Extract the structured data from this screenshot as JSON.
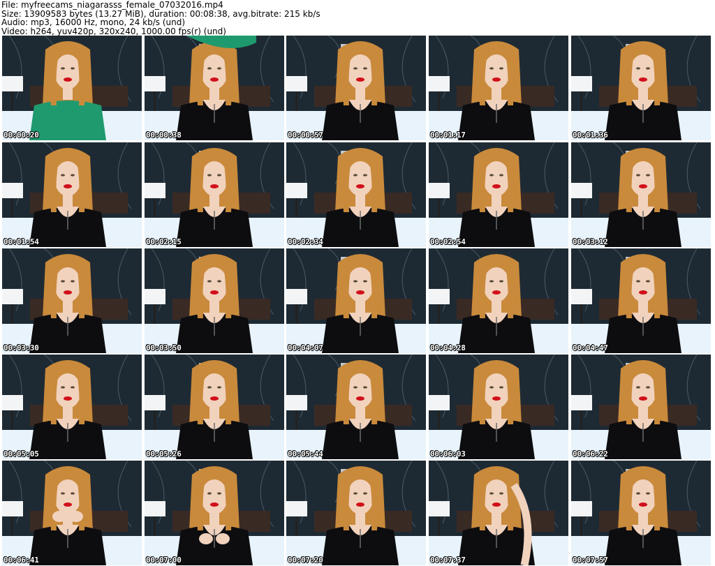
{
  "header": {
    "file_line": "File: myfreecams_niagarasss_female_07032016.mp4",
    "size_line": "Size: 13909583 bytes (13.27 MiB), duration: 00:08:38, avg.bitrate: 215 kb/s",
    "audio_line": "Audio: mp3, 16000 Hz, mono, 24 kb/s (und)",
    "video_line": "Video: h264, yuv420p, 320x240, 1000.00 fps(r) (und)"
  },
  "thumbnails": [
    {
      "timestamp": "00:00:20",
      "top": "green-sweater"
    },
    {
      "timestamp": "00:00:38",
      "top": "black-shirt-removing-sweater"
    },
    {
      "timestamp": "00:00:57",
      "top": "black-shirt"
    },
    {
      "timestamp": "00:01:17",
      "top": "black-shirt"
    },
    {
      "timestamp": "00:01:36",
      "top": "black-shirt"
    },
    {
      "timestamp": "00:01:54",
      "top": "black-shirt"
    },
    {
      "timestamp": "00:02:15",
      "top": "black-shirt"
    },
    {
      "timestamp": "00:02:34",
      "top": "black-shirt"
    },
    {
      "timestamp": "00:02:54",
      "top": "black-shirt"
    },
    {
      "timestamp": "00:03:12",
      "top": "black-shirt"
    },
    {
      "timestamp": "00:03:30",
      "top": "black-shirt"
    },
    {
      "timestamp": "00:03:50",
      "top": "black-shirt"
    },
    {
      "timestamp": "00:04:07",
      "top": "black-shirt"
    },
    {
      "timestamp": "00:04:28",
      "top": "black-shirt"
    },
    {
      "timestamp": "00:04:47",
      "top": "black-shirt"
    },
    {
      "timestamp": "00:05:05",
      "top": "black-shirt"
    },
    {
      "timestamp": "00:05:26",
      "top": "black-shirt"
    },
    {
      "timestamp": "00:05:44",
      "top": "black-shirt"
    },
    {
      "timestamp": "00:06:03",
      "top": "black-shirt"
    },
    {
      "timestamp": "00:06:22",
      "top": "black-shirt"
    },
    {
      "timestamp": "00:06:41",
      "top": "black-shirt-hands-chin"
    },
    {
      "timestamp": "00:07:00",
      "top": "black-shirt-hands-clasped"
    },
    {
      "timestamp": "00:07:20",
      "top": "black-shirt"
    },
    {
      "timestamp": "00:07:37",
      "top": "black-shirt-hand-hair"
    },
    {
      "timestamp": "00:07:57",
      "top": "black-shirt"
    }
  ],
  "colors": {
    "wall": "#1e2a33",
    "hair": "#c98a3c",
    "skin": "#f1d2bd",
    "lips": "#d0101a",
    "sweater": "#1f9a6e",
    "shirt": "#0d0d10",
    "bed": "#e8f3fb",
    "lamp": "#f2f4f6"
  }
}
